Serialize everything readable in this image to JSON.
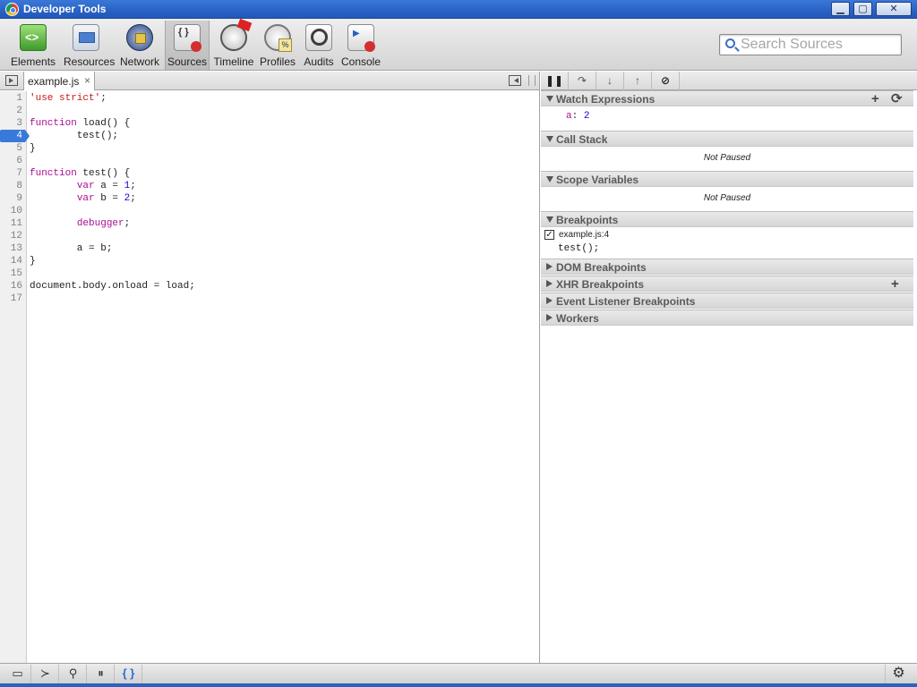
{
  "window": {
    "title": "Developer Tools",
    "minimize": "▁",
    "maximize": "▢",
    "close": "✕"
  },
  "toolbar": {
    "tools": [
      {
        "label": "Elements"
      },
      {
        "label": "Resources"
      },
      {
        "label": "Network"
      },
      {
        "label": "Sources"
      },
      {
        "label": "Timeline"
      },
      {
        "label": "Profiles"
      },
      {
        "label": "Audits"
      },
      {
        "label": "Console"
      }
    ],
    "selected": "Sources",
    "search_placeholder": "Search Sources",
    "search_value": ""
  },
  "editor": {
    "tab_label": "example.js",
    "tab_close": "×",
    "breakpoint_line": 4,
    "line_numbers": [
      "1",
      "2",
      "3",
      "4",
      "5",
      "6",
      "7",
      "8",
      "9",
      "10",
      "11",
      "12",
      "13",
      "14",
      "15",
      "16",
      "17"
    ],
    "lines": [
      "'use strict';",
      "",
      "function load() {",
      "        test();",
      "}",
      "",
      "function test() {",
      "        var a = 1;",
      "        var b = 2;",
      "",
      "        debugger;",
      "",
      "        a = b;",
      "}",
      "",
      "document.body.onload = load;",
      ""
    ]
  },
  "debugger": {
    "controls": [
      "❚❚",
      "↷",
      "↓",
      "↑",
      "⊘"
    ],
    "watch": {
      "title": "Watch Expressions",
      "add": "+",
      "refresh": "⟳",
      "expressions": [
        {
          "name": "a",
          "value": "2"
        }
      ]
    },
    "call_stack": {
      "title": "Call Stack",
      "status": "Not Paused"
    },
    "scope": {
      "title": "Scope Variables",
      "status": "Not Paused"
    },
    "breakpoints": {
      "title": "Breakpoints",
      "items": [
        {
          "location": "example.js:4",
          "code": "test();",
          "checked": true
        }
      ]
    },
    "dom_breakpoints": {
      "title": "DOM Breakpoints"
    },
    "xhr_breakpoints": {
      "title": "XHR Breakpoints",
      "add": "+"
    },
    "event_listener_breakpoints": {
      "title": "Event Listener Breakpoints"
    },
    "workers": {
      "title": "Workers"
    }
  },
  "statusbar": {
    "dock": "▭",
    "console": "≻",
    "search": "⚲",
    "pause": "⏸",
    "pretty_print": "{ }",
    "settings": "⚙"
  },
  "colors": {
    "accent": "#3879d9",
    "title_bar": "#2a62c4"
  }
}
